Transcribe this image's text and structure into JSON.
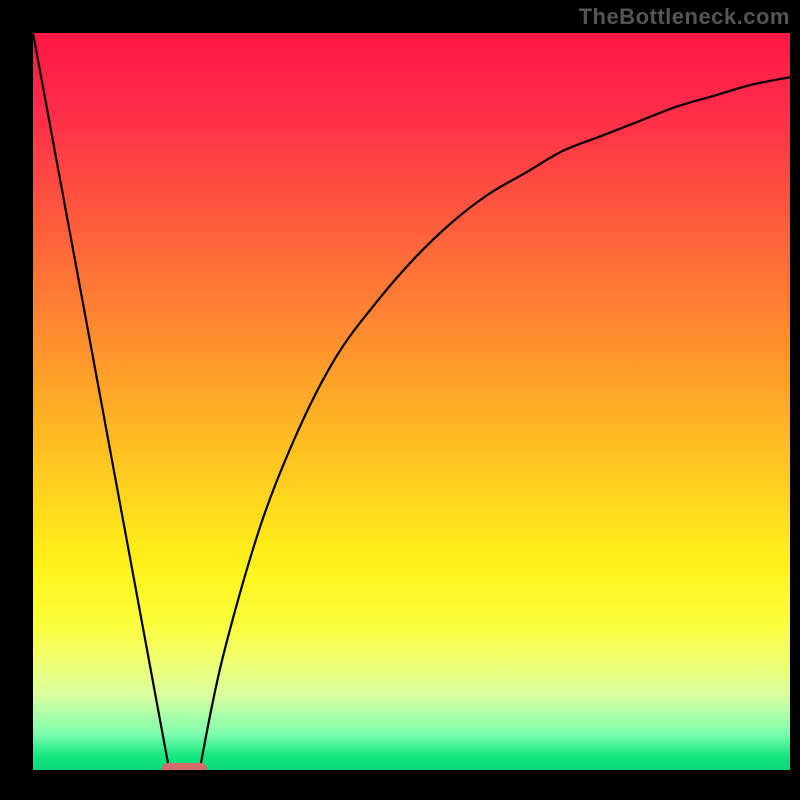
{
  "watermark": "TheBottleneck.com",
  "chart_data": {
    "type": "line",
    "title": "",
    "xlabel": "",
    "ylabel": "",
    "xlim": [
      0,
      100
    ],
    "ylim": [
      0,
      100
    ],
    "grid": false,
    "background": "heat-gradient (red top to green bottom)",
    "series": [
      {
        "name": "left-falling-line",
        "x": [
          0,
          18
        ],
        "y": [
          100,
          0
        ]
      },
      {
        "name": "right-rising-curve",
        "x": [
          22,
          25,
          30,
          35,
          40,
          45,
          50,
          55,
          60,
          65,
          70,
          75,
          80,
          85,
          90,
          95,
          100
        ],
        "y": [
          0,
          15,
          33,
          46,
          56,
          63,
          69,
          74,
          78,
          81,
          84,
          86,
          88,
          90,
          91.5,
          93,
          94
        ]
      }
    ],
    "marker": {
      "name": "optimal-point",
      "x_range": [
        17,
        23
      ],
      "y": 0,
      "color": "#d46a6a"
    }
  }
}
